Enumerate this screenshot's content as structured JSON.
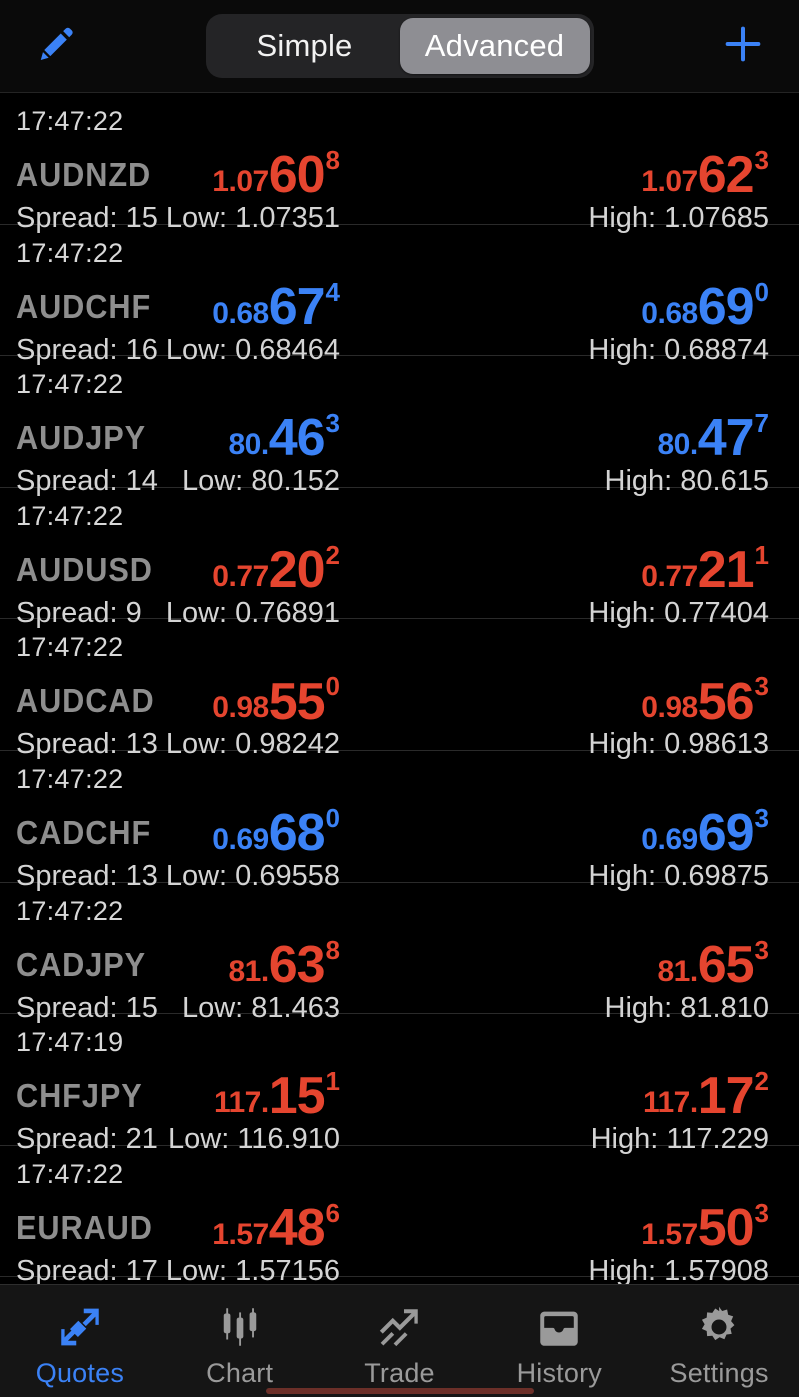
{
  "header": {
    "edit_icon": "pencil-icon",
    "add_icon": "plus-icon",
    "segmented": {
      "options": [
        "Simple",
        "Advanced"
      ],
      "selected": "Advanced"
    }
  },
  "colors": {
    "up": "#3b82f6",
    "down": "#e5452f",
    "accent": "#3b82f6",
    "symbol": "#8e8e8e",
    "text": "#d4d4d4",
    "background": "#000000"
  },
  "labels": {
    "spread_prefix": "Spread: ",
    "low_prefix": "Low: ",
    "high_prefix": "High: "
  },
  "quotes": [
    {
      "time": "17:47:22",
      "symbol": "AUDNZD",
      "spread": "Spread: 15",
      "bid": {
        "pre": "1.07",
        "big": "60",
        "sup": "8",
        "dir": "down"
      },
      "ask": {
        "pre": "1.07",
        "big": "62",
        "sup": "3",
        "dir": "down"
      },
      "low": "Low: 1.07351",
      "high": "High: 1.07685"
    },
    {
      "time": "17:47:22",
      "symbol": "AUDCHF",
      "spread": "Spread: 16",
      "bid": {
        "pre": "0.68",
        "big": "67",
        "sup": "4",
        "dir": "up"
      },
      "ask": {
        "pre": "0.68",
        "big": "69",
        "sup": "0",
        "dir": "up"
      },
      "low": "Low: 0.68464",
      "high": "High: 0.68874"
    },
    {
      "time": "17:47:22",
      "symbol": "AUDJPY",
      "spread": "Spread: 14",
      "bid": {
        "pre": "80.",
        "big": "46",
        "sup": "3",
        "dir": "up"
      },
      "ask": {
        "pre": "80.",
        "big": "47",
        "sup": "7",
        "dir": "up"
      },
      "low": "Low: 80.152",
      "high": "High: 80.615"
    },
    {
      "time": "17:47:22",
      "symbol": "AUDUSD",
      "spread": "Spread: 9",
      "bid": {
        "pre": "0.77",
        "big": "20",
        "sup": "2",
        "dir": "down"
      },
      "ask": {
        "pre": "0.77",
        "big": "21",
        "sup": "1",
        "dir": "down"
      },
      "low": "Low: 0.76891",
      "high": "High: 0.77404"
    },
    {
      "time": "17:47:22",
      "symbol": "AUDCAD",
      "spread": "Spread: 13",
      "bid": {
        "pre": "0.98",
        "big": "55",
        "sup": "0",
        "dir": "down"
      },
      "ask": {
        "pre": "0.98",
        "big": "56",
        "sup": "3",
        "dir": "down"
      },
      "low": "Low: 0.98242",
      "high": "High: 0.98613"
    },
    {
      "time": "17:47:22",
      "symbol": "CADCHF",
      "spread": "Spread: 13",
      "bid": {
        "pre": "0.69",
        "big": "68",
        "sup": "0",
        "dir": "up"
      },
      "ask": {
        "pre": "0.69",
        "big": "69",
        "sup": "3",
        "dir": "up"
      },
      "low": "Low: 0.69558",
      "high": "High: 0.69875"
    },
    {
      "time": "17:47:22",
      "symbol": "CADJPY",
      "spread": "Spread: 15",
      "bid": {
        "pre": "81.",
        "big": "63",
        "sup": "8",
        "dir": "down"
      },
      "ask": {
        "pre": "81.",
        "big": "65",
        "sup": "3",
        "dir": "down"
      },
      "low": "Low: 81.463",
      "high": "High: 81.810"
    },
    {
      "time": "17:47:19",
      "symbol": "CHFJPY",
      "spread": "Spread: 21",
      "bid": {
        "pre": "117.",
        "big": "15",
        "sup": "1",
        "dir": "down"
      },
      "ask": {
        "pre": "117.",
        "big": "17",
        "sup": "2",
        "dir": "down"
      },
      "low": "Low: 116.910",
      "high": "High: 117.229"
    },
    {
      "time": "17:47:22",
      "symbol": "EURAUD",
      "spread": "Spread: 17",
      "bid": {
        "pre": "1.57",
        "big": "48",
        "sup": "6",
        "dir": "down"
      },
      "ask": {
        "pre": "1.57",
        "big": "50",
        "sup": "3",
        "dir": "down"
      },
      "low": "Low: 1.57156",
      "high": "High: 1.57908"
    }
  ],
  "tabbar": {
    "active": "Quotes",
    "items": [
      {
        "label": "Quotes",
        "icon": "two-way-arrows-icon"
      },
      {
        "label": "Chart",
        "icon": "candlestick-icon"
      },
      {
        "label": "Trade",
        "icon": "trend-arrow-icon"
      },
      {
        "label": "History",
        "icon": "inbox-tray-icon"
      },
      {
        "label": "Settings",
        "icon": "gear-icon"
      }
    ]
  }
}
